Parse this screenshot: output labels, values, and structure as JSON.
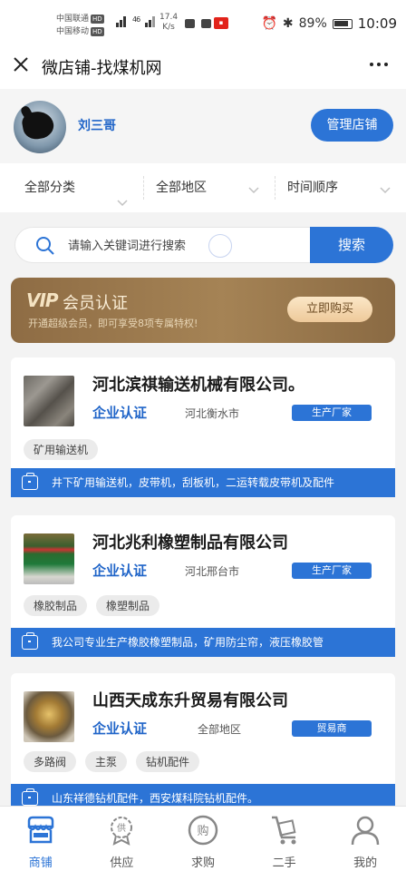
{
  "status_bar": {
    "carrier1": "中国联通",
    "carrier2": "中国移动",
    "hd": "HD",
    "signal_4g": "46",
    "speed_value": "17.4",
    "speed_unit": "K/s",
    "battery": "89%",
    "time": "10:09"
  },
  "title_bar": {
    "title": "微店铺-找煤机网"
  },
  "profile": {
    "username": "刘三哥",
    "manage_label": "管理店铺"
  },
  "filters": [
    {
      "label": "全部分类"
    },
    {
      "label": "全部地区"
    },
    {
      "label": "时间顺序"
    }
  ],
  "search": {
    "placeholder": "请输入关键词进行搜索",
    "button_label": "搜索"
  },
  "vip": {
    "badge": "VIP",
    "title": "会员认证",
    "subtitle": "开通超级会员，即可享受8项专属特权!",
    "button_label": "立即购买"
  },
  "companies": [
    {
      "name": "河北滨祺输送机械有限公司。",
      "certification": "企业认证",
      "region": "河北衡水市",
      "type": "生产厂家",
      "tags": [
        "矿用输送机"
      ],
      "description": "井下矿用输送机，皮带机，刮板机，二运转载皮带机及配件"
    },
    {
      "name": "河北兆利橡塑制品有限公司",
      "certification": "企业认证",
      "region": "河北邢台市",
      "type": "生产厂家",
      "tags": [
        "橡胶制品",
        "橡塑制品"
      ],
      "description": "我公司专业生产橡胶橡塑制品，矿用防尘帘，液压橡胶管"
    },
    {
      "name": "山西天成东升贸易有限公司",
      "certification": "企业认证",
      "region": "全部地区",
      "type": "贸易商",
      "tags": [
        "多路阀",
        "主泵",
        "钻机配件"
      ],
      "description": "山东祥德钻机配件，西安煤科院钻机配件。"
    }
  ],
  "tab_bar": [
    {
      "label": "商铺",
      "icon": "shop-icon",
      "active": true
    },
    {
      "label": "供应",
      "icon": "supply-icon",
      "active": false
    },
    {
      "label": "求购",
      "icon": "buy-icon",
      "active": false
    },
    {
      "label": "二手",
      "icon": "cart-icon",
      "active": false
    },
    {
      "label": "我的",
      "icon": "user-icon",
      "active": false
    }
  ],
  "colors": {
    "accent": "#2c74d6",
    "vip_gold": "#a58355"
  }
}
